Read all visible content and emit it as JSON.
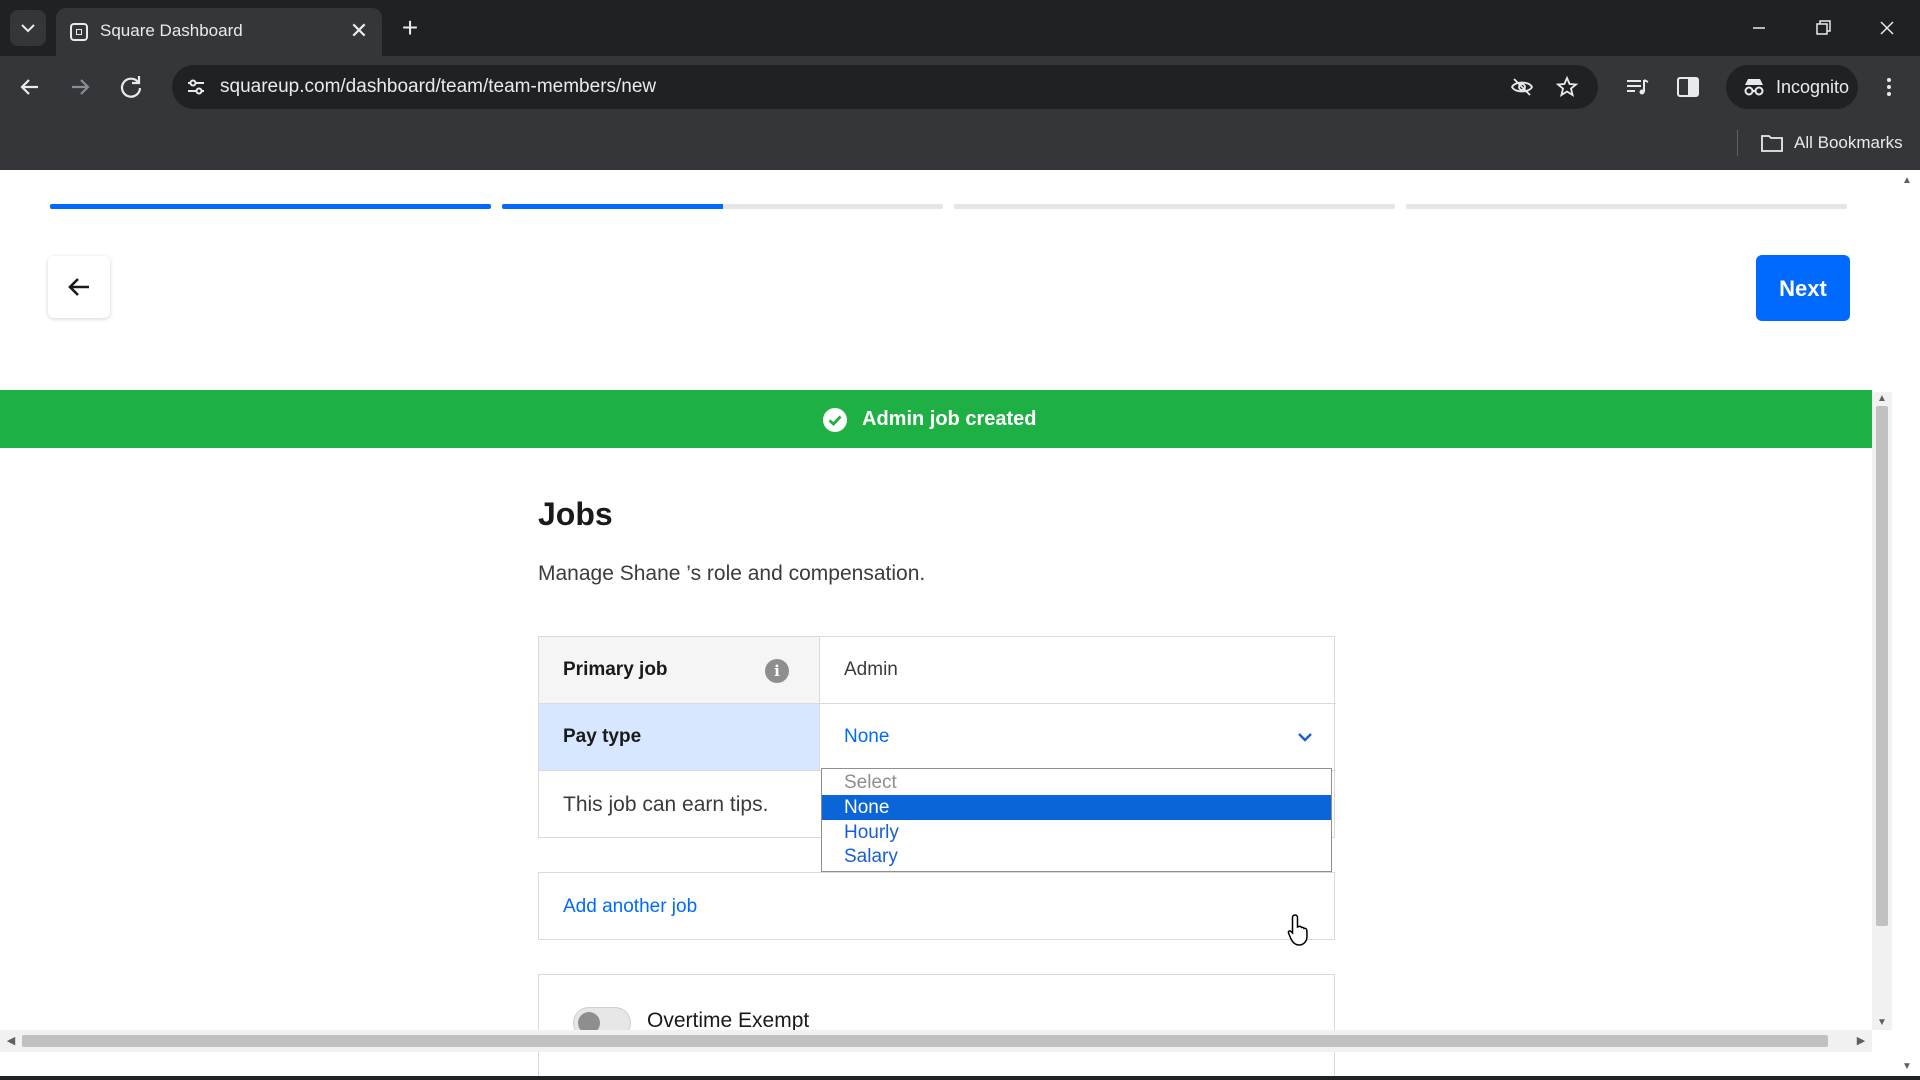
{
  "browser": {
    "tab_title": "Square Dashboard",
    "tab_close": "✕",
    "new_tab": "+",
    "url": "squareup.com/dashboard/team/team-members/new",
    "incognito_label": "Incognito",
    "bookmarks_label": "All Bookmarks"
  },
  "progress": {
    "steps": [
      1.0,
      0.5,
      0.0,
      0.0
    ]
  },
  "header": {
    "next_label": "Next"
  },
  "toast": {
    "message": "Admin job created",
    "color": "#1fb045"
  },
  "jobs": {
    "title": "Jobs",
    "subtitle": "Manage Shane ’s role and compensation.",
    "primary_job_label": "Primary job",
    "primary_job_value": "Admin",
    "pay_type_label": "Pay type",
    "pay_type_value": "None",
    "tips_text": "This job can earn tips.",
    "pay_type_options": [
      "Select",
      "None",
      "Hourly",
      "Salary"
    ],
    "pay_type_selected": "None",
    "add_job_label": "Add another job",
    "overtime_label": "Overtime Exempt",
    "overtime_enabled": false
  },
  "colors": {
    "accent": "#006aff",
    "success": "#1fb045",
    "selection_highlight": "#d6e7ff"
  },
  "icons": [
    "tab-search-icon",
    "square-logo-icon",
    "back-arrow-icon",
    "forward-arrow-icon",
    "reload-icon",
    "site-settings-icon",
    "eye-off-icon",
    "star-icon",
    "media-controls-icon",
    "side-panel-icon",
    "incognito-icon",
    "kebab-menu-icon",
    "folder-icon",
    "arrow-left-icon",
    "check-circle-icon",
    "info-icon",
    "chevron-down-icon"
  ]
}
